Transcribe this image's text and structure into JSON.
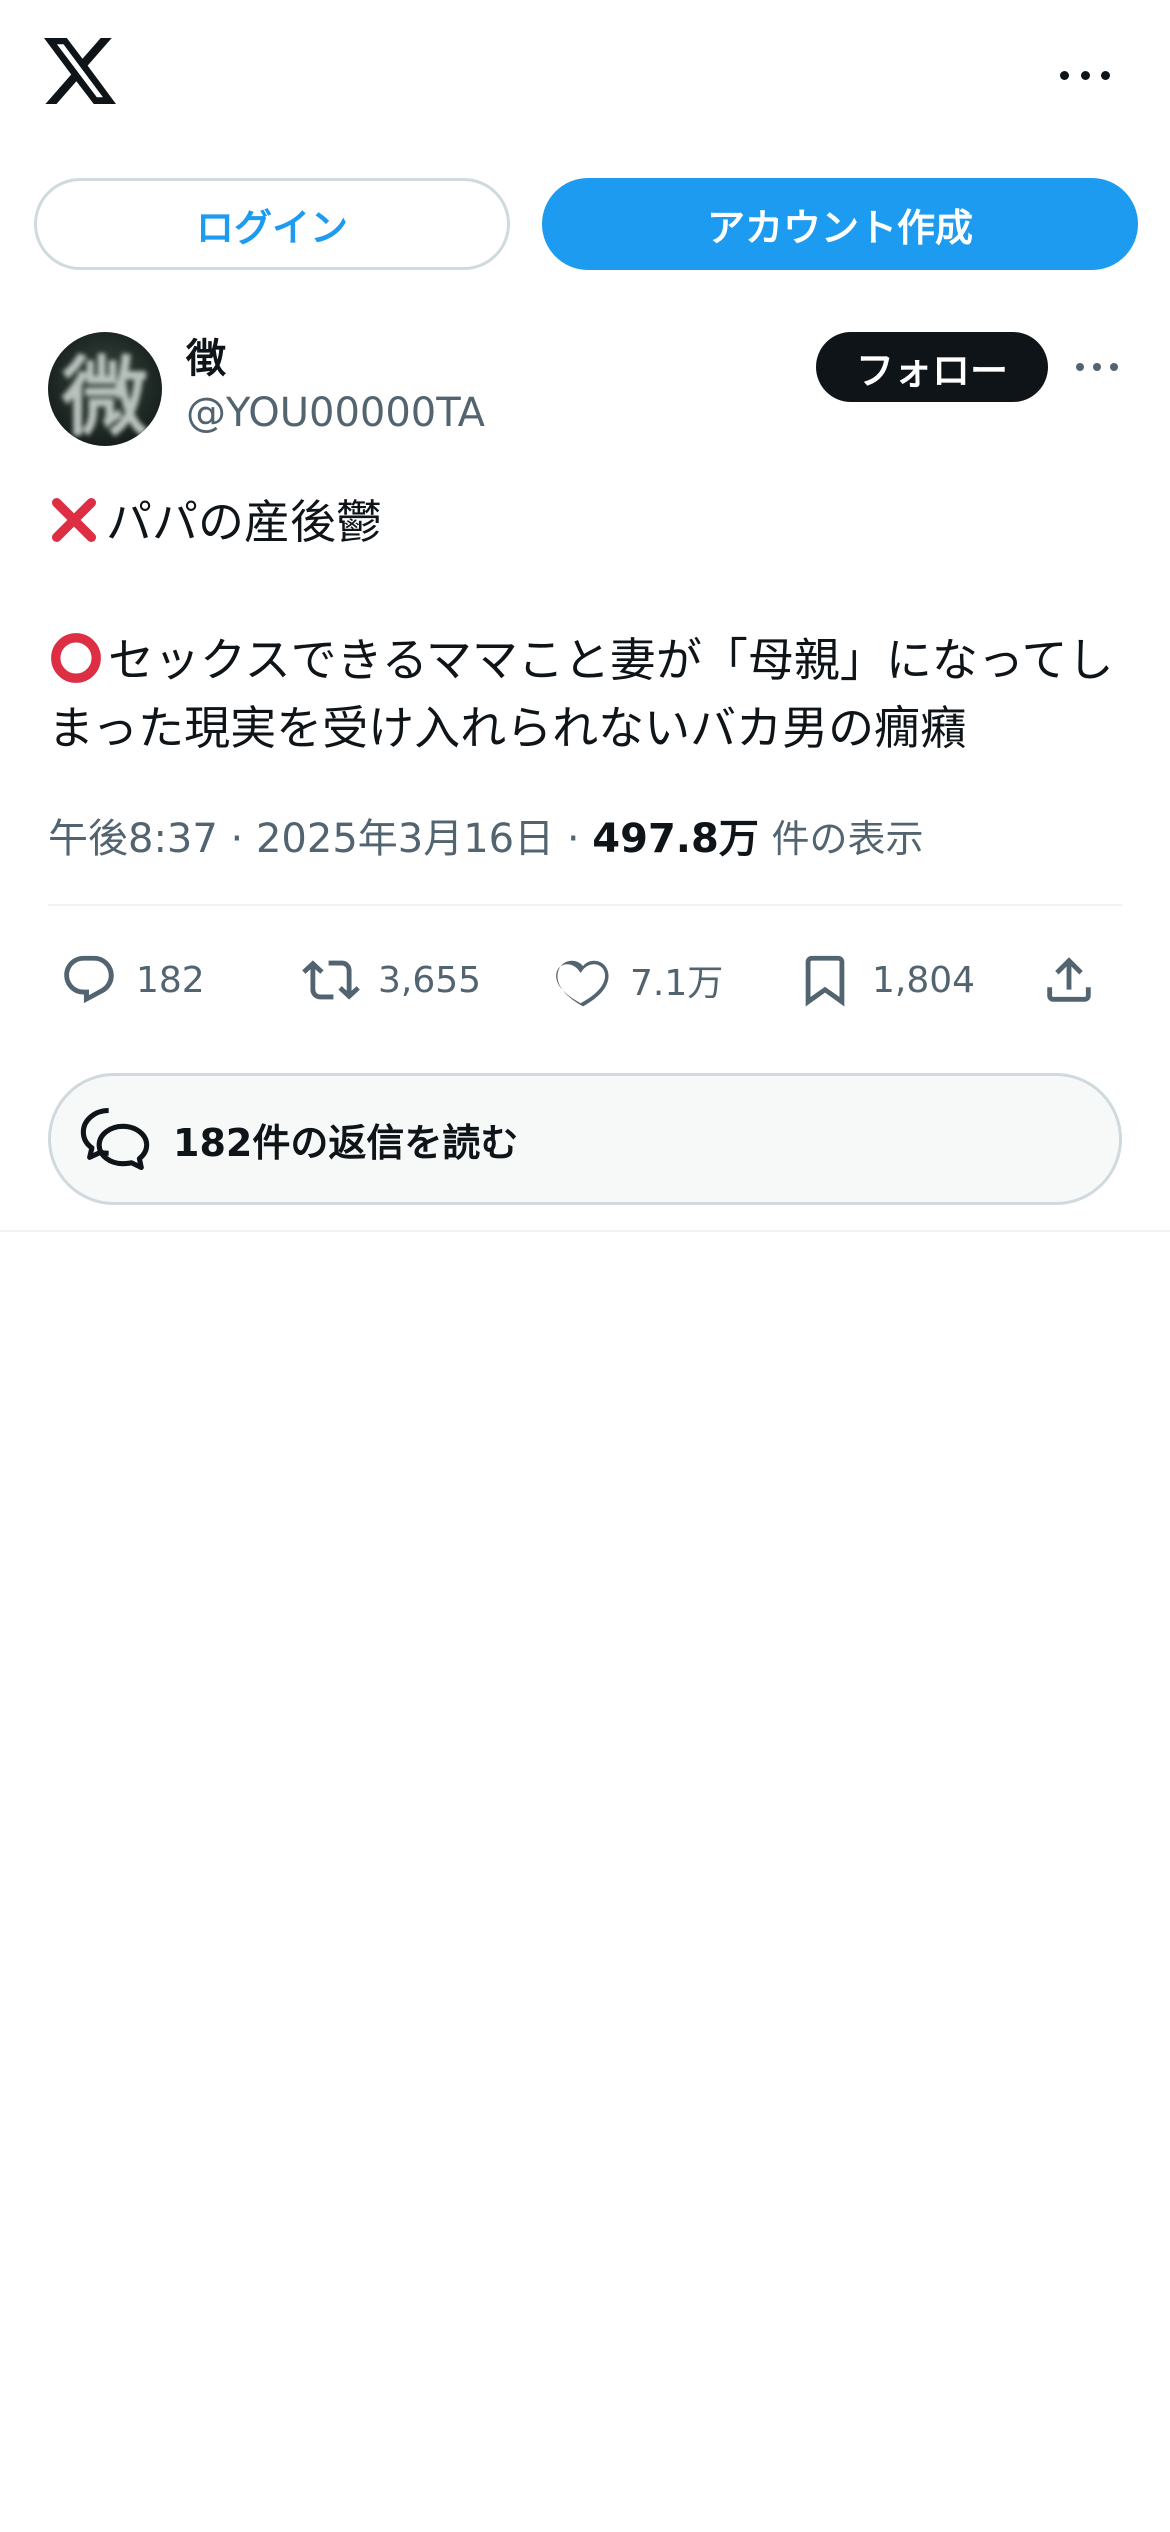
{
  "header": {
    "logo_icon": "x-logo-icon",
    "more_icon": "more-horizontal-icon"
  },
  "auth": {
    "login_label": "ログイン",
    "signup_label": "アカウント作成"
  },
  "post": {
    "author": {
      "avatar_glyph": "微",
      "name": "徴",
      "handle": "@YOU00000TA"
    },
    "follow_label": "フォロー",
    "text_line1": "パパの産後鬱",
    "text_line2": "セックスできるママこと妻が「母親」になってしまった現実を受け入れられないバカ男の癇癪",
    "emoji_1": "cross-mark-icon",
    "emoji_2": "heavy-circle-icon",
    "time": "午後8:37",
    "separator": "·",
    "date": "2025年3月16日",
    "views_count": "497.8万",
    "views_label": "件の表示"
  },
  "actions": {
    "replies": "182",
    "reposts": "3,655",
    "likes": "7.1万",
    "bookmarks": "1,804"
  },
  "read_replies_label": "182件の返信を読む",
  "colors": {
    "accent": "#1d9bf0",
    "text": "#0f1419",
    "secondary": "#536471",
    "border": "#cfd9de",
    "cross_mark": "#dd2e44"
  }
}
